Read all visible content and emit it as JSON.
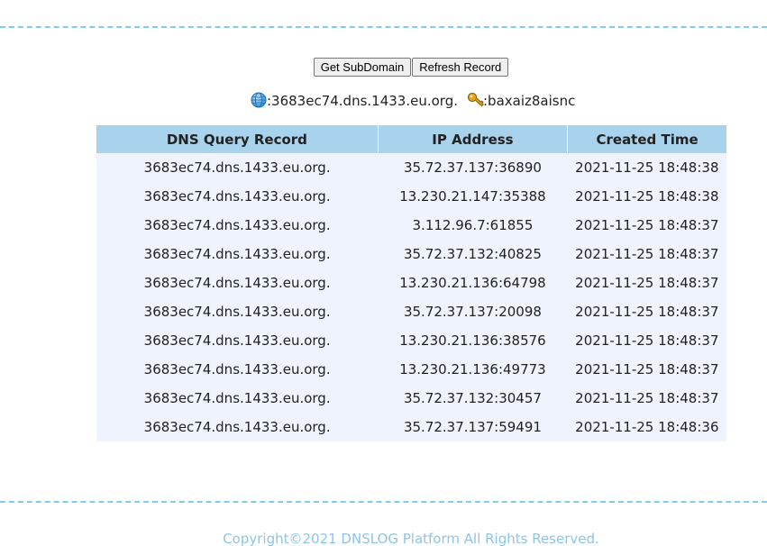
{
  "toolbar": {
    "get_subdomain_label": "Get SubDomain",
    "refresh_record_label": "Refresh Record"
  },
  "info": {
    "subdomain_icon": "globe-icon",
    "subdomain": ":3683ec74.dns.1433.eu.org.",
    "token_icon": "key-icon",
    "token": ":baxaiz8aisnc"
  },
  "table": {
    "headers": [
      "DNS Query Record",
      "IP Address",
      "Created Time"
    ],
    "rows": [
      [
        "3683ec74.dns.1433.eu.org.",
        "35.72.37.137:36890",
        "2021-11-25 18:48:38"
      ],
      [
        "3683ec74.dns.1433.eu.org.",
        "13.230.21.147:35388",
        "2021-11-25 18:48:38"
      ],
      [
        "3683ec74.dns.1433.eu.org.",
        "3.112.96.7:61855",
        "2021-11-25 18:48:37"
      ],
      [
        "3683ec74.dns.1433.eu.org.",
        "35.72.37.132:40825",
        "2021-11-25 18:48:37"
      ],
      [
        "3683ec74.dns.1433.eu.org.",
        "13.230.21.136:64798",
        "2021-11-25 18:48:37"
      ],
      [
        "3683ec74.dns.1433.eu.org.",
        "35.72.37.137:20098",
        "2021-11-25 18:48:37"
      ],
      [
        "3683ec74.dns.1433.eu.org.",
        "13.230.21.136:38576",
        "2021-11-25 18:48:37"
      ],
      [
        "3683ec74.dns.1433.eu.org.",
        "13.230.21.136:49773",
        "2021-11-25 18:48:37"
      ],
      [
        "3683ec74.dns.1433.eu.org.",
        "35.72.37.132:30457",
        "2021-11-25 18:48:37"
      ],
      [
        "3683ec74.dns.1433.eu.org.",
        "35.72.37.137:59491",
        "2021-11-25 18:48:36"
      ]
    ]
  },
  "footer": {
    "copyright": "Copyright©2021 DNSLOG Platform All Rights Reserved."
  },
  "colors": {
    "divider": "#7fcdea",
    "header_bg": "#a9d2ec",
    "row_bg": "#eef3fe",
    "footer_text": "#8ec5e6"
  }
}
